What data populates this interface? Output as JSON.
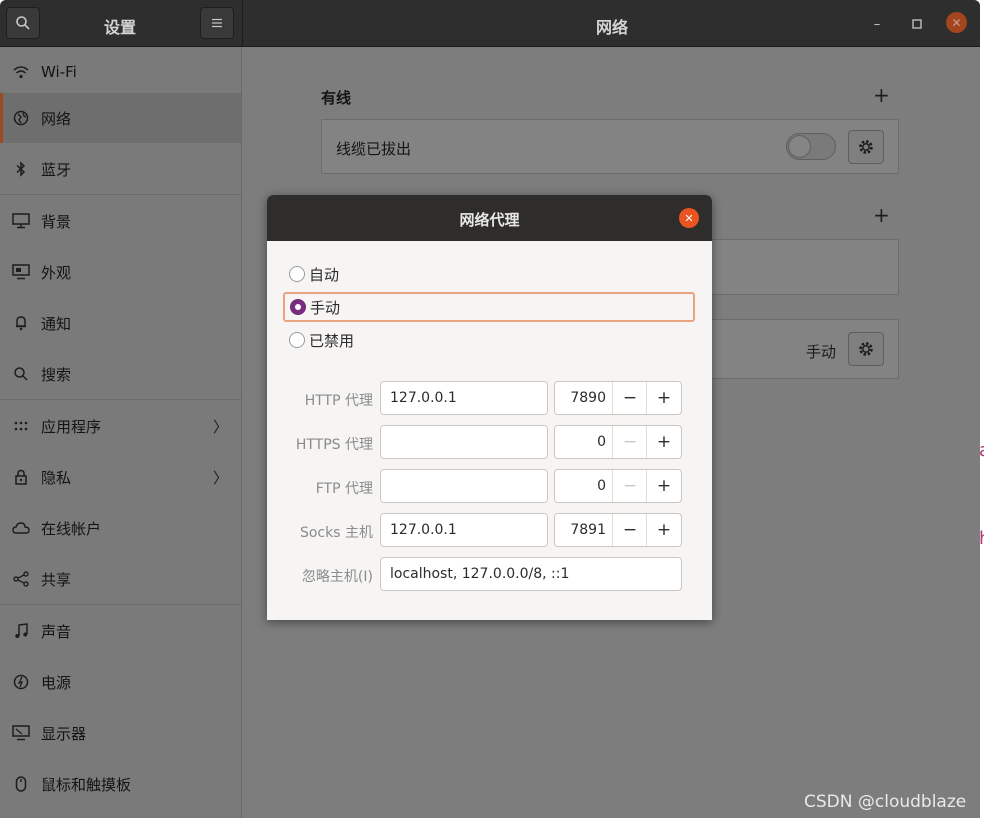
{
  "header": {
    "left_title": "设置",
    "right_title": "网络",
    "search_icon": "search-icon",
    "menu_icon": "hamburger-menu-icon",
    "window_controls": {
      "minimize": "–",
      "maximize": "□",
      "close": "✕"
    }
  },
  "sidebar": {
    "items": [
      {
        "label": "Wi-Fi",
        "icon": "wifi-icon"
      },
      {
        "label": "网络",
        "icon": "network-icon",
        "selected": true
      },
      {
        "label": "蓝牙",
        "icon": "bluetooth-icon"
      },
      {
        "label": "背景",
        "icon": "background-icon"
      },
      {
        "label": "外观",
        "icon": "appearance-icon"
      },
      {
        "label": "通知",
        "icon": "notification-icon"
      },
      {
        "label": "搜索",
        "icon": "search-icon"
      },
      {
        "label": "应用程序",
        "icon": "apps-icon",
        "chevron": "〉"
      },
      {
        "label": "隐私",
        "icon": "lock-icon",
        "chevron": "〉"
      },
      {
        "label": "在线帐户",
        "icon": "cloud-icon"
      },
      {
        "label": "共享",
        "icon": "share-icon"
      },
      {
        "label": "声音",
        "icon": "music-note-icon"
      },
      {
        "label": "电源",
        "icon": "power-icon"
      },
      {
        "label": "显示器",
        "icon": "display-icon"
      },
      {
        "label": "鼠标和触摸板",
        "icon": "mouse-icon"
      }
    ]
  },
  "main": {
    "wired": {
      "title": "有线",
      "add": "+",
      "status": "线缆已拔出"
    },
    "vpn": {
      "add": "+"
    },
    "proxy": {
      "value": "手动"
    }
  },
  "dialog": {
    "title": "网络代理",
    "modes": [
      {
        "label": "自动",
        "selected": false
      },
      {
        "label": "手动",
        "selected": true
      },
      {
        "label": "已禁用",
        "selected": false
      }
    ],
    "fields": [
      {
        "label": "HTTP 代理",
        "host": "127.0.0.1",
        "port": "7890",
        "minus_enabled": true
      },
      {
        "label": "HTTPS 代理",
        "host": "",
        "port": "0",
        "minus_enabled": false
      },
      {
        "label": "FTP 代理",
        "host": "",
        "port": "0",
        "minus_enabled": false
      },
      {
        "label": "Socks 主机",
        "host": "127.0.0.1",
        "port": "7891",
        "minus_enabled": true
      }
    ],
    "ignore": {
      "label": "忽略主机(I)",
      "value": "localhost, 127.0.0.0/8, ::1"
    },
    "spin_minus": "−",
    "spin_plus": "+"
  },
  "watermark": "CSDN @cloudblaze",
  "colors": {
    "accent": "#e95420",
    "radio": "#7a2d80",
    "header": "#2e2e2e"
  }
}
